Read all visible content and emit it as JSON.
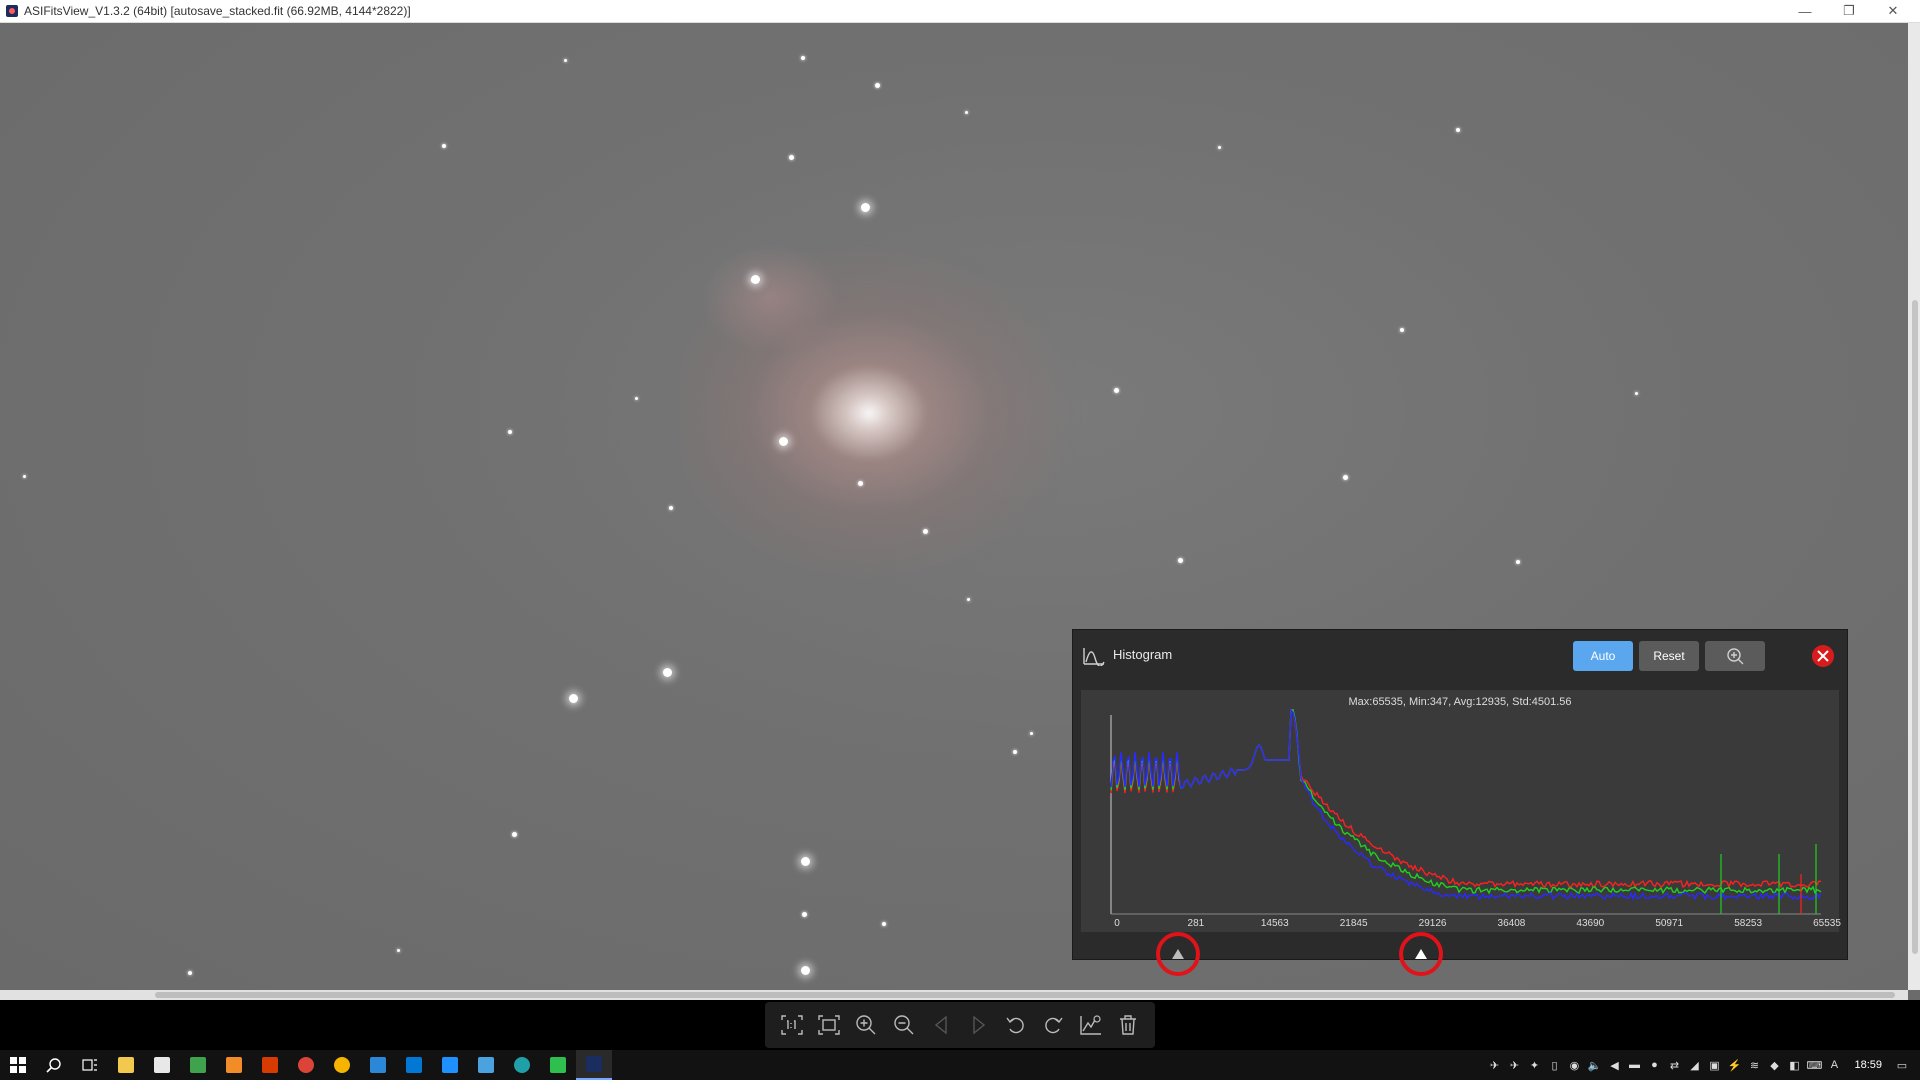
{
  "window": {
    "title": "ASIFitsView_V1.3.2 (64bit) [autosave_stacked.fit (66.92MB, 4144*2822)]",
    "minimize_glyph": "—",
    "restore_glyph": "❐",
    "close_glyph": "✕"
  },
  "histogram": {
    "title": "Histogram",
    "auto_label": "Auto",
    "reset_label": "Reset",
    "stats": "Max:65535, Min:347, Avg:12935, Std:4501.56",
    "x_ticks": [
      "0",
      "281",
      "14563",
      "21845",
      "29126",
      "36408",
      "43690",
      "50971",
      "58253",
      "65535"
    ],
    "colors": {
      "red": "#ff2020",
      "green": "#20d020",
      "blue": "#2a2aff",
      "accent": "#5aa7f0",
      "close": "#d81b1b"
    }
  },
  "toolbar": {
    "icons": [
      "fit-1to1-icon",
      "fit-window-icon",
      "zoom-in-icon",
      "zoom-out-icon",
      "previous-icon",
      "next-icon",
      "rotate-left-icon",
      "rotate-right-icon",
      "histogram-icon",
      "delete-icon"
    ]
  },
  "taskbar": {
    "time": "18:59",
    "ime": "A"
  }
}
